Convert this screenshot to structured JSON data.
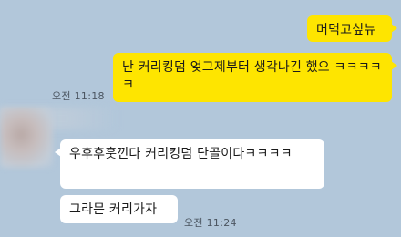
{
  "messages": [
    {
      "sender": "me",
      "text": "머먹고싶뉴"
    },
    {
      "sender": "me",
      "text": "난 커리킹덤 엊그제부터 생각나긴 했으 ㅋㅋㅋㅋㅋ",
      "time": "오전 11:18"
    },
    {
      "sender": "friend",
      "text": "우후후훗낀다 커리킹덤 단골이다ㅋㅋㅋㅋ"
    },
    {
      "sender": "friend",
      "text": "그라믄 커리가자",
      "time": "오전 11:24"
    }
  ],
  "colors": {
    "background": "#b2c7da",
    "my_bubble": "#fee500",
    "friend_bubble": "#ffffff"
  }
}
